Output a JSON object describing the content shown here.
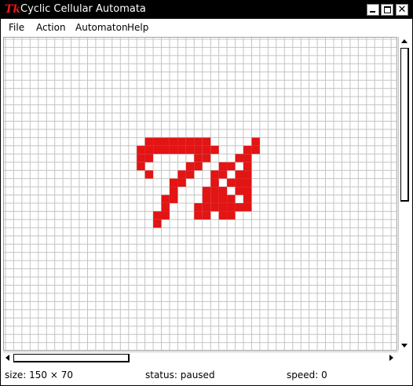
{
  "window": {
    "title": "Cyclic Cellular Automata",
    "logo_text": "Tk",
    "close_glyph": "✕"
  },
  "menu": {
    "items": [
      "File",
      "Action",
      "Automaton",
      "Help"
    ]
  },
  "grid": {
    "cell_on_color": "#e31414",
    "grid_line_color": "#c4c4c4",
    "background": "#ffffff",
    "live_cells": [
      [
        12,
        17
      ],
      [
        12,
        18
      ],
      [
        12,
        19
      ],
      [
        12,
        20
      ],
      [
        12,
        21
      ],
      [
        12,
        22
      ],
      [
        12,
        23
      ],
      [
        12,
        24
      ],
      [
        12,
        30
      ],
      [
        13,
        16
      ],
      [
        13,
        17
      ],
      [
        13,
        18
      ],
      [
        13,
        19
      ],
      [
        13,
        20
      ],
      [
        13,
        21
      ],
      [
        13,
        22
      ],
      [
        13,
        23
      ],
      [
        13,
        24
      ],
      [
        13,
        25
      ],
      [
        13,
        29
      ],
      [
        13,
        30
      ],
      [
        14,
        16
      ],
      [
        14,
        17
      ],
      [
        14,
        23
      ],
      [
        14,
        24
      ],
      [
        14,
        28
      ],
      [
        14,
        29
      ],
      [
        15,
        16
      ],
      [
        15,
        22
      ],
      [
        15,
        23
      ],
      [
        15,
        26
      ],
      [
        15,
        27
      ],
      [
        15,
        29
      ],
      [
        16,
        17
      ],
      [
        16,
        21
      ],
      [
        16,
        22
      ],
      [
        16,
        25
      ],
      [
        16,
        26
      ],
      [
        16,
        28
      ],
      [
        16,
        29
      ],
      [
        17,
        20
      ],
      [
        17,
        21
      ],
      [
        17,
        25
      ],
      [
        17,
        27
      ],
      [
        17,
        28
      ],
      [
        17,
        29
      ],
      [
        18,
        20
      ],
      [
        18,
        24
      ],
      [
        18,
        25
      ],
      [
        18,
        26
      ],
      [
        18,
        28
      ],
      [
        18,
        29
      ],
      [
        19,
        19
      ],
      [
        19,
        20
      ],
      [
        19,
        24
      ],
      [
        19,
        25
      ],
      [
        19,
        26
      ],
      [
        19,
        27
      ],
      [
        19,
        29
      ],
      [
        20,
        19
      ],
      [
        20,
        23
      ],
      [
        20,
        24
      ],
      [
        20,
        25
      ],
      [
        20,
        26
      ],
      [
        20,
        27
      ],
      [
        20,
        28
      ],
      [
        20,
        29
      ],
      [
        21,
        18
      ],
      [
        21,
        19
      ],
      [
        21,
        23
      ],
      [
        21,
        24
      ],
      [
        21,
        26
      ],
      [
        21,
        27
      ],
      [
        22,
        18
      ]
    ]
  },
  "status": {
    "size": "size: 150 × 70",
    "state": "status: paused",
    "speed": "speed: 0"
  }
}
